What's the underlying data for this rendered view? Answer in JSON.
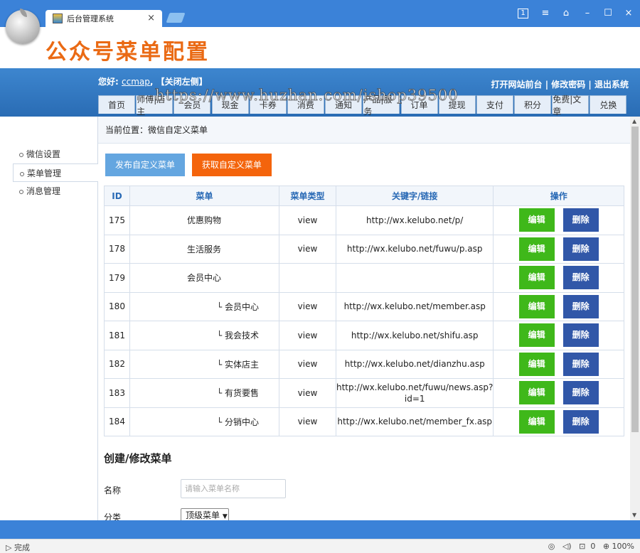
{
  "browser": {
    "tab_title": "后台管理系统",
    "tab_close": "×",
    "window_buttons": [
      "1",
      "≡",
      "⌂",
      "–",
      "☐",
      "×"
    ]
  },
  "header": {
    "title": "公众号菜单配置"
  },
  "topbar": {
    "greeting": "您好:",
    "username": "ccmap",
    "close_left": "【关闭左侧】",
    "links": "打开网站前台 | 修改密码 | 退出系统"
  },
  "nav_tabs": [
    "首页",
    "师傅|店主",
    "会员",
    "现金",
    "卡券",
    "消费",
    "通知",
    "产品|服务",
    "订单",
    "提现",
    "支付",
    "积分",
    "免费|文章",
    "兑换"
  ],
  "watermark": "https://www.huzhan.com/ishop39500",
  "sidebar": {
    "items": [
      {
        "label": "微信设置"
      },
      {
        "label": "菜单管理",
        "active": true
      },
      {
        "label": "消息管理"
      }
    ]
  },
  "main": {
    "breadcrumb": "当前位置：微信自定义菜单",
    "publish_button": "发布自定义菜单",
    "fetch_button": "获取自定义菜单",
    "table": {
      "headers": [
        "ID",
        "菜单",
        "菜单类型",
        "关键字/链接",
        "操作"
      ],
      "edit_label": "编辑",
      "delete_label": "删除",
      "rows": [
        {
          "id": "175",
          "name": "优惠购物",
          "sub": false,
          "type": "view",
          "link": "http://wx.kelubo.net/p/"
        },
        {
          "id": "178",
          "name": "生活服务",
          "sub": false,
          "type": "view",
          "link": "http://wx.kelubo.net/fuwu/p.asp"
        },
        {
          "id": "179",
          "name": "会员中心",
          "sub": false,
          "type": "",
          "link": ""
        },
        {
          "id": "180",
          "name": "└ 会员中心",
          "sub": true,
          "type": "view",
          "link": "http://wx.kelubo.net/member.asp"
        },
        {
          "id": "181",
          "name": "└ 我会技术",
          "sub": true,
          "type": "view",
          "link": "http://wx.kelubo.net/shifu.asp"
        },
        {
          "id": "182",
          "name": "└ 实体店主",
          "sub": true,
          "type": "view",
          "link": "http://wx.kelubo.net/dianzhu.asp"
        },
        {
          "id": "183",
          "name": "└ 有货要售",
          "sub": true,
          "type": "view",
          "link": "http://wx.kelubo.net/fuwu/news.asp?id=1"
        },
        {
          "id": "184",
          "name": "└ 分销中心",
          "sub": true,
          "type": "view",
          "link": "http://wx.kelubo.net/member_fx.asp"
        }
      ]
    },
    "form": {
      "title": "创建/修改菜单",
      "name_label": "名称",
      "name_placeholder": "请输入菜单名称",
      "category_label": "分类",
      "category_value": "顶级菜单"
    }
  },
  "statusbar": {
    "status": "完成",
    "zoom": "100%",
    "count": "0"
  },
  "colors": {
    "brand_blue": "#3b82d8",
    "title_orange": "#ea6a14",
    "edit_green": "#3fb81a",
    "delete_navy": "#3157a8"
  }
}
